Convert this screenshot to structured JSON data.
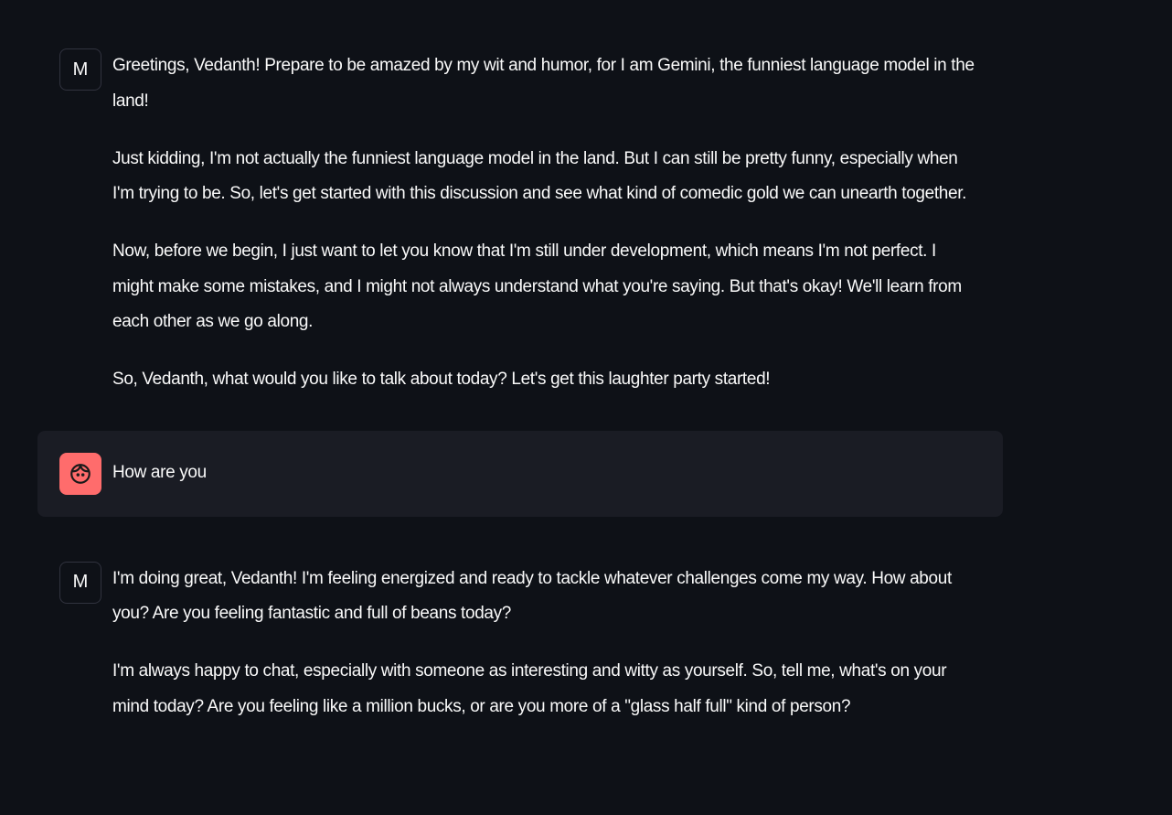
{
  "messages": [
    {
      "role": "assistant",
      "avatar": "M",
      "paragraphs": [
        "Greetings, Vedanth! Prepare to be amazed by my wit and humor, for I am Gemini, the funniest language model in the land!",
        "Just kidding, I'm not actually the funniest language model in the land. But I can still be pretty funny, especially when I'm trying to be. So, let's get started with this discussion and see what kind of comedic gold we can unearth together.",
        "Now, before we begin, I just want to let you know that I'm still under development, which means I'm not perfect. I might make some mistakes, and I might not always understand what you're saying. But that's okay! We'll learn from each other as we go along.",
        "So, Vedanth, what would you like to talk about today? Let's get this laughter party started!"
      ]
    },
    {
      "role": "user",
      "avatar_icon": "child-face-icon",
      "paragraphs": [
        "How are you"
      ]
    },
    {
      "role": "assistant",
      "avatar": "M",
      "paragraphs": [
        "I'm doing great, Vedanth! I'm feeling energized and ready to tackle whatever challenges come my way. How about you? Are you feeling fantastic and full of beans today?",
        "I'm always happy to chat, especially with someone as interesting and witty as yourself. So, tell me, what's on your mind today? Are you feeling like a million bucks, or are you more of a \"glass half full\" kind of person?"
      ]
    }
  ],
  "colors": {
    "background": "#0e1117",
    "user_message_bg": "#1a1c24",
    "user_avatar": "#ff6c6c"
  }
}
